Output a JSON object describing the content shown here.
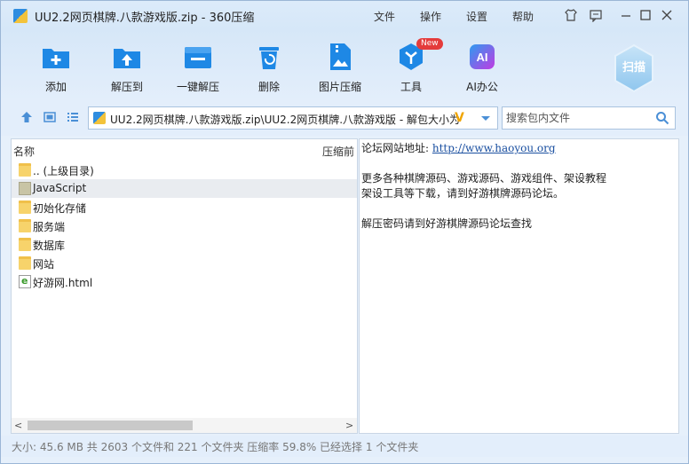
{
  "window": {
    "title": "UU2.2网页棋牌.八款游戏版.zip - 360压缩",
    "menus": [
      "文件",
      "操作",
      "设置",
      "帮助"
    ]
  },
  "toolbar": {
    "items": [
      {
        "label": "添加",
        "icon": "add-icon"
      },
      {
        "label": "解压到",
        "icon": "extract-to-icon"
      },
      {
        "label": "一键解压",
        "icon": "one-click-extract-icon"
      },
      {
        "label": "删除",
        "icon": "delete-icon"
      },
      {
        "label": "图片压缩",
        "icon": "image-compress-icon"
      },
      {
        "label": "工具",
        "icon": "tools-icon",
        "badge": "New"
      },
      {
        "label": "AI办公",
        "icon": "ai-office-icon",
        "icon_text": "AI"
      }
    ],
    "scan_label": "扫描"
  },
  "address": {
    "path": "UU2.2网页棋牌.八款游戏版.zip\\UU2.2网页棋牌.八款游戏版 - 解包大小为",
    "search_placeholder": "搜索包内文件"
  },
  "filelist": {
    "col_name": "名称",
    "col_rate": "压缩前",
    "rows": [
      {
        "name": ".. (上级目录)",
        "type": "folder",
        "selected": false
      },
      {
        "name": "JavaScript",
        "type": "folder-grey",
        "selected": true
      },
      {
        "name": "初始化存储",
        "type": "folder",
        "selected": false
      },
      {
        "name": "服务端",
        "type": "folder",
        "selected": false
      },
      {
        "name": "数据库",
        "type": "folder",
        "selected": false
      },
      {
        "name": "网站",
        "type": "folder",
        "selected": false
      },
      {
        "name": "好游网.html",
        "type": "html",
        "selected": false
      }
    ]
  },
  "preview": {
    "line1_label": "论坛网站地址:",
    "line1_link": "http://www.haoyou.org",
    "line2": "更多各种棋牌源码、游戏源码、游戏组件、架设教程",
    "line3": "架设工具等下载，请到好游棋牌源码论坛。",
    "line4": "解压密码请到好游棋牌源码论坛查找"
  },
  "status": {
    "text": "大小: 45.6 MB 共 2603 个文件和 221 个文件夹 压缩率 59.8% 已经选择 1 个文件夹"
  },
  "colors": {
    "accent": "#1e88e5",
    "window_bg": "#e6f0fb",
    "new_badge": "#e43b3b"
  }
}
